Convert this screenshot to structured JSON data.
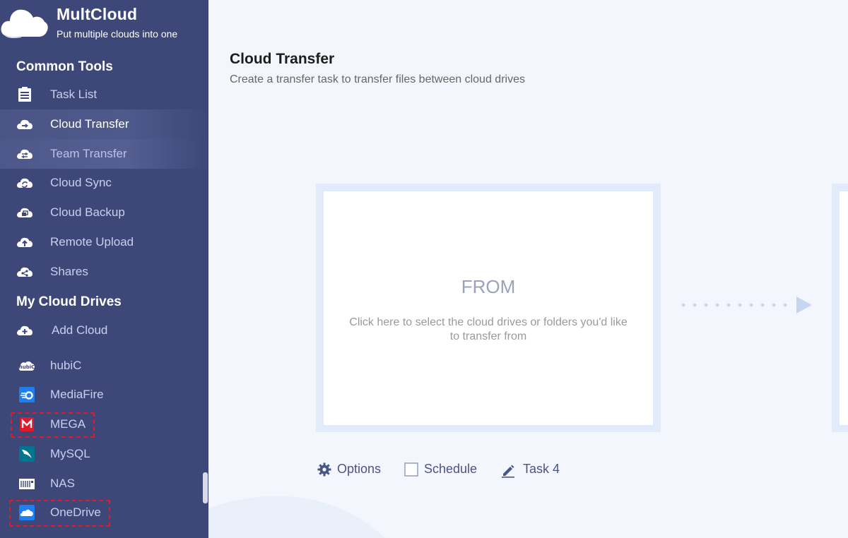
{
  "brand": {
    "name": "MultCloud",
    "tagline": "Put multiple clouds into one"
  },
  "sidebar": {
    "common_tools_title": "Common Tools",
    "tools": [
      {
        "label": "Task List",
        "icon": "task-list-icon"
      },
      {
        "label": "Cloud Transfer",
        "icon": "cloud-transfer-icon",
        "active": true
      },
      {
        "label": "Team Transfer",
        "icon": "team-transfer-icon",
        "hover": true
      },
      {
        "label": "Cloud Sync",
        "icon": "cloud-sync-icon"
      },
      {
        "label": "Cloud Backup",
        "icon": "cloud-backup-icon"
      },
      {
        "label": "Remote Upload",
        "icon": "remote-upload-icon"
      },
      {
        "label": "Shares",
        "icon": "shares-icon"
      }
    ],
    "my_drives_title": "My Cloud Drives",
    "add_cloud_label": "Add Cloud",
    "drives": [
      {
        "label": "hubiC",
        "icon": "hubic-icon"
      },
      {
        "label": "MediaFire",
        "icon": "mediafire-icon"
      },
      {
        "label": "MEGA",
        "icon": "mega-icon",
        "highlighted": true
      },
      {
        "label": "MySQL",
        "icon": "mysql-icon"
      },
      {
        "label": "NAS",
        "icon": "nas-icon"
      },
      {
        "label": "OneDrive",
        "icon": "onedrive-icon",
        "highlighted": true
      }
    ]
  },
  "main": {
    "title": "Cloud Transfer",
    "subtitle": "Create a transfer task to transfer files between cloud drives",
    "from_panel": {
      "title": "FROM",
      "description": "Click here to select the cloud drives or folders you'd like to transfer from"
    },
    "options_label": "Options",
    "schedule_label": "Schedule",
    "task_name": "Task 4"
  },
  "colors": {
    "sidebar_bg": "#3d4778",
    "main_bg": "#f3f7fd",
    "accent": "#4a5485",
    "highlight_border": "#e0192b"
  }
}
